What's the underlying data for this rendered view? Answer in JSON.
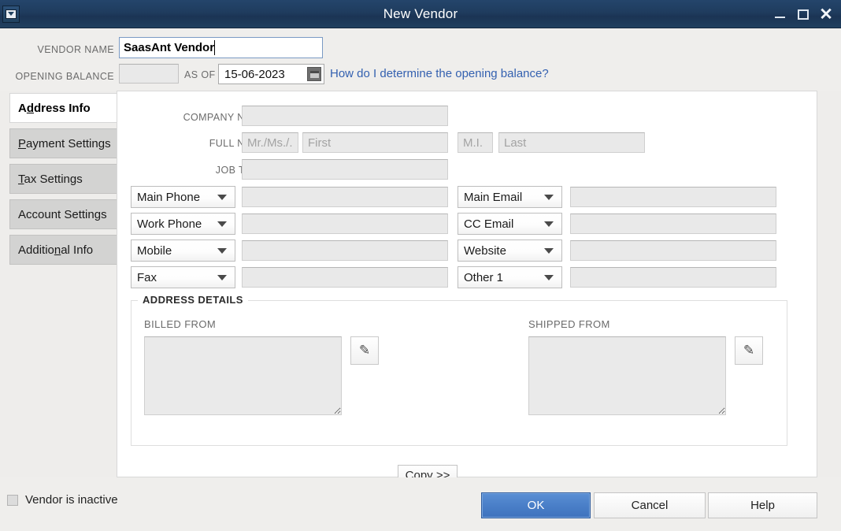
{
  "window": {
    "title": "New Vendor",
    "sysmenu_icon": "window-menu-icon",
    "minimize_icon": "minimize-icon",
    "maximize_icon": "maximize-icon",
    "close_icon": "close-icon",
    "close_glyph": "✕",
    "titlebar_color": "#1f3c5e"
  },
  "header": {
    "vendor_name_label": "VENDOR NAME",
    "vendor_name_value": "SaasAnt Vendor",
    "opening_balance_label": "OPENING BALANCE",
    "opening_balance_value": "",
    "as_of_label": "AS OF",
    "as_of_value": "15-06-2023",
    "calendar_icon": "calendar-icon",
    "help_link": "How do I determine the opening balance?",
    "link_color": "#3461b0"
  },
  "tabs": [
    {
      "label": "Address Info",
      "accel_index": 1,
      "active": true
    },
    {
      "label": "Payment Settings",
      "accel_index": 0,
      "active": false
    },
    {
      "label": "Tax Settings",
      "accel_index": 0,
      "active": false
    },
    {
      "label": "Account Settings",
      "accel_index": 14,
      "active": false
    },
    {
      "label": "Additional Info",
      "accel_index": 7,
      "active": false
    }
  ],
  "address_info": {
    "company_name_label": "COMPANY NAME",
    "company_name_value": "",
    "full_name_label": "FULL NAME",
    "salutation_placeholder": "Mr./Ms./..",
    "salutation_value": "",
    "first_placeholder": "First",
    "first_value": "",
    "mi_placeholder": "M.I.",
    "mi_value": "",
    "last_placeholder": "Last",
    "last_value": "",
    "job_title_label": "JOB TITLE",
    "job_title_value": "",
    "contact_rows_left": [
      {
        "type": "Main Phone",
        "value": ""
      },
      {
        "type": "Work Phone",
        "value": ""
      },
      {
        "type": "Mobile",
        "value": ""
      },
      {
        "type": "Fax",
        "value": ""
      }
    ],
    "contact_rows_right": [
      {
        "type": "Main Email",
        "value": ""
      },
      {
        "type": "CC Email",
        "value": ""
      },
      {
        "type": "Website",
        "value": ""
      },
      {
        "type": "Other 1",
        "value": ""
      }
    ],
    "address_details": {
      "legend": "ADDRESS DETAILS",
      "billed_from_label": "BILLED FROM",
      "billed_from_value": "",
      "shipped_from_label": "SHIPPED FROM",
      "shipped_from_value": "",
      "copy_button": "Copy >>",
      "edit_icon": "pencil-icon",
      "edit_glyph": "✎"
    }
  },
  "footer": {
    "inactive_label": "Vendor is inactive",
    "inactive_checked": false,
    "ok_label": "OK",
    "cancel_label": "Cancel",
    "help_label": "Help",
    "ok_color": "#4a7fc8"
  }
}
